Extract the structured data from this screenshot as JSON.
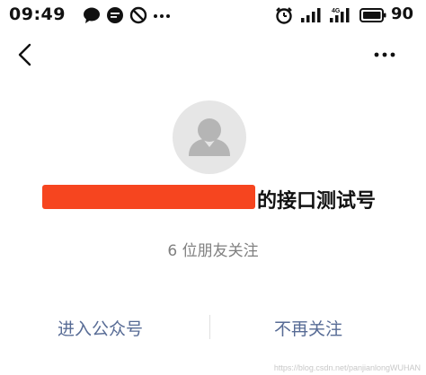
{
  "status_bar": {
    "time": "09:49",
    "network_label": "4G",
    "battery_level": "90",
    "icons": [
      "chat-bubble-icon",
      "message-icon",
      "no-disturb-icon",
      "more-dots-icon",
      "alarm-icon",
      "signal-icon",
      "signal-4g-icon",
      "battery-icon"
    ]
  },
  "nav": {
    "back_icon": "chevron-left-icon",
    "more_icon": "more-horizontal-icon"
  },
  "profile": {
    "name_suffix": "的接口测试号",
    "followers_text": "6 位朋友关注"
  },
  "actions": {
    "enter_label": "进入公众号",
    "unfollow_label": "不再关注"
  },
  "watermark": "https://blog.csdn.net/panjianlongWUHAN",
  "colors": {
    "link": "#576b95",
    "redaction": "#f6451f",
    "secondary_text": "#808080",
    "avatar_bg": "#e6e6e6"
  }
}
